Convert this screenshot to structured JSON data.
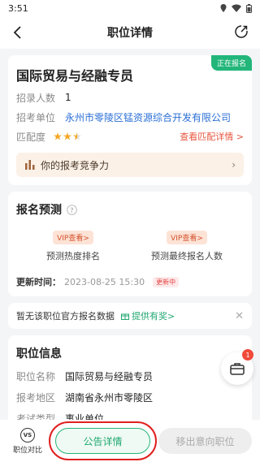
{
  "status_bar": {
    "time": "3:51"
  },
  "nav": {
    "title": "职位详情"
  },
  "job": {
    "title": "国际贸易与经融专员",
    "status": "正在报名",
    "recruit_label": "招录人数",
    "recruit_value": "1",
    "unit_label": "招考单位",
    "unit_value": "永州市零陵区锰资源综合开发有限公司",
    "match_label": "匹配度",
    "match_stars": 2.5,
    "match_link": "查看匹配详情 >",
    "compete_text": "你的报考竞争力"
  },
  "predict": {
    "title": "报名预测",
    "items": [
      {
        "vip": "VIP查看>",
        "label": "预测热度排名"
      },
      {
        "vip": "VIP查看>",
        "label": "预测最终报名人数"
      }
    ],
    "update_label": "更新时间：",
    "update_time": "2023-08-25 15:30",
    "update_badge": "更新中"
  },
  "notice": {
    "text": "暂无该职位官方报名数据",
    "reward": "提供有奖>"
  },
  "position_info": {
    "title": "职位信息",
    "rows": [
      {
        "label": "职位名称",
        "value": "国际贸易与经融专员"
      },
      {
        "label": "报考地区",
        "value": "湖南省永州市零陵区"
      },
      {
        "label": "考试类型",
        "value": "事业单位"
      }
    ]
  },
  "float": {
    "badge": "1"
  },
  "bottom": {
    "compare_icon": "VS",
    "compare_label": "职位对比",
    "announce": "公告详情",
    "remove": "移出意向职位"
  },
  "colors": {
    "accent": "#23b67a",
    "link": "#2b6fd6",
    "warn": "#e8553e"
  }
}
